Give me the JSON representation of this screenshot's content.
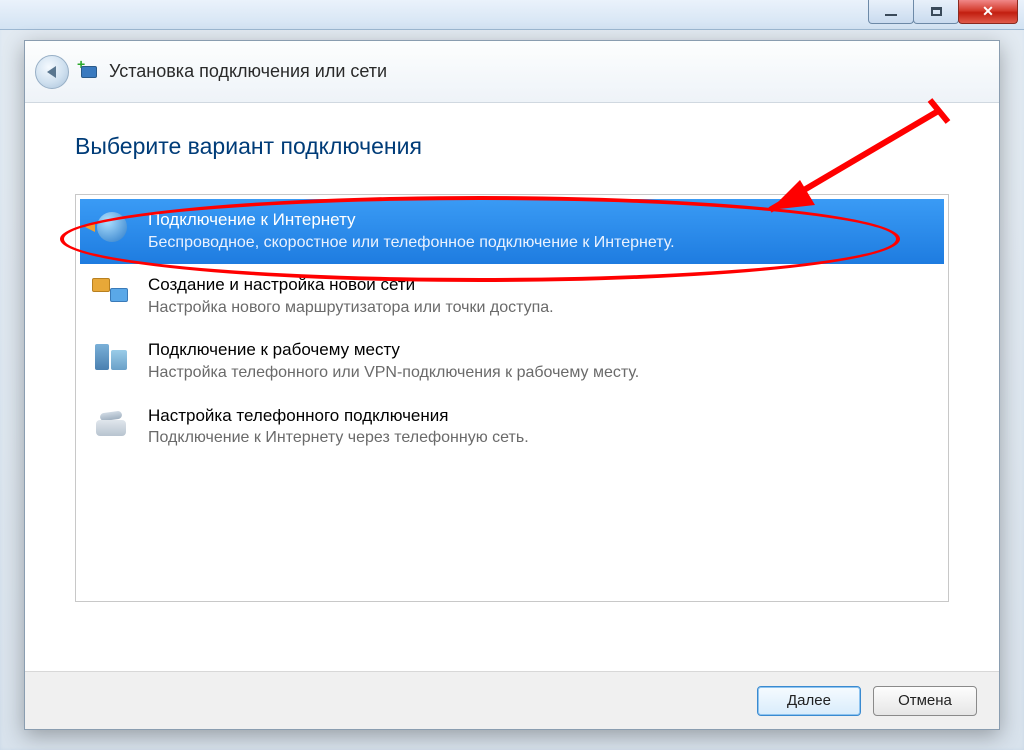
{
  "window": {
    "title": "Установка подключения или сети"
  },
  "heading": "Выберите вариант подключения",
  "options": [
    {
      "title": "Подключение к Интернету",
      "subtitle": "Беспроводное, скоростное или телефонное подключение к Интернету."
    },
    {
      "title": "Создание и настройка новой сети",
      "subtitle": "Настройка нового маршрутизатора или точки доступа."
    },
    {
      "title": "Подключение к рабочему месту",
      "subtitle": "Настройка телефонного или VPN-подключения к рабочему месту."
    },
    {
      "title": "Настройка телефонного подключения",
      "subtitle": "Подключение к Интернету через телефонную сеть."
    }
  ],
  "buttons": {
    "next": "Далее",
    "cancel": "Отмена"
  },
  "colors": {
    "selected_bg": "#1e7ce0",
    "heading_color": "#003c78",
    "annotation_color": "#ff0000"
  }
}
